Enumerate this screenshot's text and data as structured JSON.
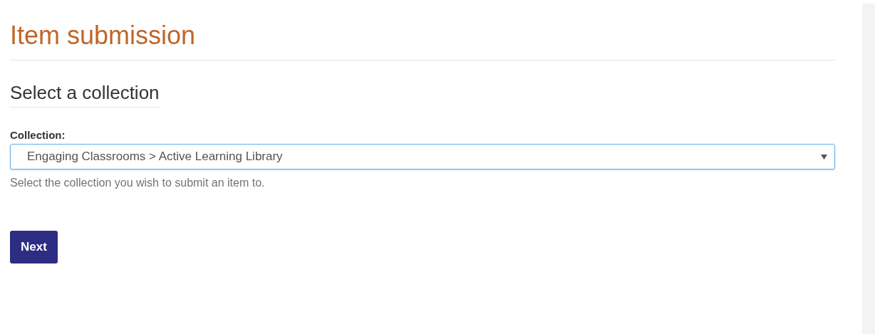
{
  "page_title": "Item submission",
  "section_title": "Select a collection",
  "collection_field": {
    "label": "Collection:",
    "value": "Engaging Classrooms > Active Learning Library",
    "focused": true,
    "help": "Select the collection you wish to submit an item to."
  },
  "buttons": [
    {
      "label": "Next"
    }
  ]
}
